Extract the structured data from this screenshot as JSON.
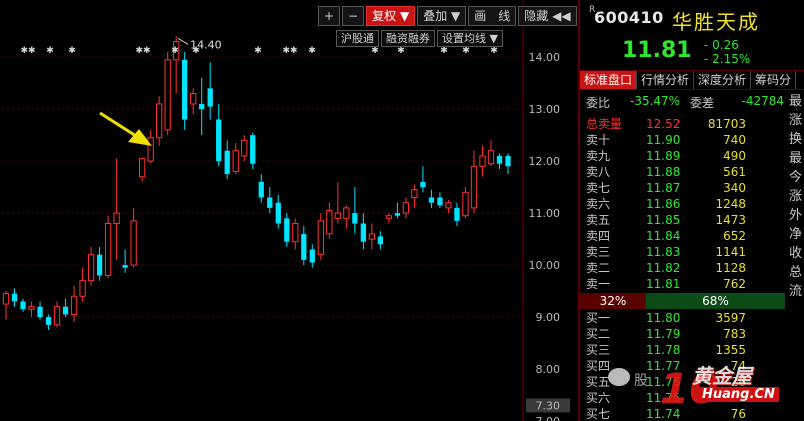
{
  "toolbar": {
    "plus": "+",
    "minus": "−",
    "adjust": "复权",
    "adjust_arrow": "▼",
    "overlay": "叠加",
    "overlay_arrow": "▼",
    "draw": "画　线",
    "hide": "隐藏",
    "hide_arrows": "◀◀"
  },
  "subbar": {
    "hk_connect": "沪股通",
    "margin": "融资融券",
    "ma_setting": "设置均线",
    "ma_arrow": "▼"
  },
  "header": {
    "r_mark": "R",
    "code": "600410",
    "name": "华胜天成",
    "price": "11.81",
    "change": "- 0.26",
    "change_pct": "- 2.15%"
  },
  "tabs": [
    "标准盘口",
    "行情分析",
    "深度分析",
    "筹码分"
  ],
  "ratio": {
    "wb_label": "委比",
    "wb_value": "-35.47%",
    "wc_label": "委差",
    "wc_value": "-42784"
  },
  "sell_total": {
    "label": "总卖量",
    "price": "12.52",
    "volume": "81703"
  },
  "asks": [
    {
      "label": "卖十",
      "price": "11.90",
      "volume": "740"
    },
    {
      "label": "卖九",
      "price": "11.89",
      "volume": "490"
    },
    {
      "label": "卖八",
      "price": "11.88",
      "volume": "561"
    },
    {
      "label": "卖七",
      "price": "11.87",
      "volume": "340"
    },
    {
      "label": "卖六",
      "price": "11.86",
      "volume": "1248"
    },
    {
      "label": "卖五",
      "price": "11.85",
      "volume": "1473"
    },
    {
      "label": "卖四",
      "price": "11.84",
      "volume": "652"
    },
    {
      "label": "卖三",
      "price": "11.83",
      "volume": "1141"
    },
    {
      "label": "卖二",
      "price": "11.82",
      "volume": "1128"
    },
    {
      "label": "卖一",
      "price": "11.81",
      "volume": "762"
    }
  ],
  "ratio_bar": {
    "sell_pct": "32%",
    "buy_pct": "68%"
  },
  "bids": [
    {
      "label": "买一",
      "price": "11.80",
      "volume": "3597"
    },
    {
      "label": "买二",
      "price": "11.79",
      "volume": "783"
    },
    {
      "label": "买三",
      "price": "11.78",
      "volume": "1355"
    },
    {
      "label": "买四",
      "price": "11.77",
      "volume": "74"
    },
    {
      "label": "买五",
      "price": "11.76",
      "volume": "26"
    },
    {
      "label": "买六",
      "price": "11.75",
      "volume": "13"
    },
    {
      "label": "买七",
      "price": "11.74",
      "volume": "76"
    }
  ],
  "side_labels": [
    "最",
    "涨",
    "换",
    "最",
    "今",
    "涨",
    "外",
    "净",
    "收",
    "总",
    "流"
  ],
  "watermark": {
    "brand": "黄金屋",
    "logo": "10",
    "url": "Huang.CN",
    "text": "股"
  },
  "colors": {
    "up": "#ff3232",
    "down": "#00e5ff",
    "accent": "#c81414",
    "price_down": "#2ee82e",
    "volume": "#e8e030"
  },
  "chart_data": {
    "type": "candlestick",
    "y_ticks": [
      "14.00",
      "13.00",
      "12.00",
      "11.00",
      "10.00",
      "9.00",
      "8.00",
      "7.30",
      "7.00"
    ],
    "ylim": [
      7.0,
      15.1
    ],
    "peak_label": "14.40",
    "event_markers": [
      "✱✱",
      "✱",
      "✱",
      "✱✱",
      "✱",
      "✱",
      "✱",
      "✱✱",
      "✱",
      "✱",
      "✱",
      "✱",
      "✱",
      "✱"
    ],
    "candles": [
      {
        "o": 9.25,
        "h": 9.5,
        "l": 8.95,
        "c": 9.45
      },
      {
        "o": 9.45,
        "h": 9.55,
        "l": 9.2,
        "c": 9.3
      },
      {
        "o": 9.3,
        "h": 9.35,
        "l": 9.1,
        "c": 9.15
      },
      {
        "o": 9.15,
        "h": 9.3,
        "l": 9.0,
        "c": 9.2
      },
      {
        "o": 9.2,
        "h": 9.3,
        "l": 8.95,
        "c": 9.0
      },
      {
        "o": 9.0,
        "h": 9.05,
        "l": 8.75,
        "c": 8.85
      },
      {
        "o": 8.85,
        "h": 9.3,
        "l": 8.8,
        "c": 9.2
      },
      {
        "o": 9.2,
        "h": 9.35,
        "l": 9.0,
        "c": 9.05
      },
      {
        "o": 9.05,
        "h": 9.6,
        "l": 8.9,
        "c": 9.4
      },
      {
        "o": 9.4,
        "h": 9.95,
        "l": 9.3,
        "c": 9.7
      },
      {
        "o": 9.7,
        "h": 10.35,
        "l": 9.6,
        "c": 10.2
      },
      {
        "o": 10.2,
        "h": 10.35,
        "l": 9.7,
        "c": 9.8
      },
      {
        "o": 9.8,
        "h": 10.95,
        "l": 9.75,
        "c": 10.8
      },
      {
        "o": 10.8,
        "h": 12.05,
        "l": 10.1,
        "c": 11.0
      },
      {
        "o": 10.0,
        "h": 10.3,
        "l": 9.85,
        "c": 9.95
      },
      {
        "o": 10.0,
        "h": 11.1,
        "l": 9.95,
        "c": 10.85
      },
      {
        "o": 11.7,
        "h": 12.0,
        "l": 11.6,
        "c": 12.05
      },
      {
        "o": 12.0,
        "h": 12.6,
        "l": 11.95,
        "c": 12.45
      },
      {
        "o": 12.45,
        "h": 13.25,
        "l": 12.3,
        "c": 13.1
      },
      {
        "o": 12.6,
        "h": 14.1,
        "l": 12.5,
        "c": 13.95
      },
      {
        "o": 13.95,
        "h": 14.4,
        "l": 13.3,
        "c": 14.3
      },
      {
        "o": 13.95,
        "h": 14.1,
        "l": 12.6,
        "c": 12.8
      },
      {
        "o": 13.1,
        "h": 13.4,
        "l": 12.9,
        "c": 13.3
      },
      {
        "o": 13.1,
        "h": 13.6,
        "l": 12.5,
        "c": 13.0
      },
      {
        "o": 13.4,
        "h": 13.9,
        "l": 12.8,
        "c": 13.05
      },
      {
        "o": 12.8,
        "h": 13.1,
        "l": 11.9,
        "c": 12.0
      },
      {
        "o": 12.2,
        "h": 12.4,
        "l": 11.65,
        "c": 11.75
      },
      {
        "o": 11.8,
        "h": 12.35,
        "l": 11.75,
        "c": 12.2
      },
      {
        "o": 12.1,
        "h": 12.5,
        "l": 12.0,
        "c": 12.4
      },
      {
        "o": 12.5,
        "h": 12.55,
        "l": 11.85,
        "c": 11.95
      },
      {
        "o": 11.6,
        "h": 11.75,
        "l": 11.2,
        "c": 11.3
      },
      {
        "o": 11.3,
        "h": 11.5,
        "l": 11.0,
        "c": 11.1
      },
      {
        "o": 11.2,
        "h": 11.35,
        "l": 10.7,
        "c": 10.8
      },
      {
        "o": 10.9,
        "h": 11.0,
        "l": 10.35,
        "c": 10.45
      },
      {
        "o": 10.45,
        "h": 10.9,
        "l": 10.3,
        "c": 10.8
      },
      {
        "o": 10.6,
        "h": 10.75,
        "l": 10.0,
        "c": 10.1
      },
      {
        "o": 10.3,
        "h": 10.4,
        "l": 9.95,
        "c": 10.05
      },
      {
        "o": 10.2,
        "h": 11.0,
        "l": 10.1,
        "c": 10.85
      },
      {
        "o": 10.6,
        "h": 11.2,
        "l": 10.5,
        "c": 11.05
      },
      {
        "o": 10.9,
        "h": 11.6,
        "l": 10.8,
        "c": 11.0
      },
      {
        "o": 10.9,
        "h": 11.15,
        "l": 10.7,
        "c": 11.1
      },
      {
        "o": 11.0,
        "h": 11.5,
        "l": 10.6,
        "c": 10.8
      },
      {
        "o": 10.8,
        "h": 11.0,
        "l": 10.3,
        "c": 10.45
      },
      {
        "o": 10.5,
        "h": 10.8,
        "l": 10.3,
        "c": 10.6
      },
      {
        "o": 10.55,
        "h": 10.65,
        "l": 10.3,
        "c": 10.4
      },
      {
        "o": 10.9,
        "h": 11.0,
        "l": 10.8,
        "c": 10.95
      },
      {
        "o": 11.0,
        "h": 11.2,
        "l": 10.9,
        "c": 10.95
      },
      {
        "o": 11.0,
        "h": 11.3,
        "l": 10.9,
        "c": 11.2
      },
      {
        "o": 11.3,
        "h": 11.55,
        "l": 11.1,
        "c": 11.45
      },
      {
        "o": 11.6,
        "h": 11.9,
        "l": 11.4,
        "c": 11.5
      },
      {
        "o": 11.3,
        "h": 11.45,
        "l": 11.1,
        "c": 11.2
      },
      {
        "o": 11.3,
        "h": 11.4,
        "l": 11.1,
        "c": 11.15
      },
      {
        "o": 11.1,
        "h": 11.25,
        "l": 11.0,
        "c": 11.2
      },
      {
        "o": 11.1,
        "h": 11.2,
        "l": 10.75,
        "c": 10.85
      },
      {
        "o": 10.95,
        "h": 11.5,
        "l": 10.9,
        "c": 11.4
      },
      {
        "o": 11.1,
        "h": 12.2,
        "l": 11.0,
        "c": 11.9
      },
      {
        "o": 11.9,
        "h": 12.3,
        "l": 11.7,
        "c": 12.1
      },
      {
        "o": 11.95,
        "h": 12.4,
        "l": 11.9,
        "c": 12.2
      },
      {
        "o": 12.1,
        "h": 12.15,
        "l": 11.85,
        "c": 11.95
      },
      {
        "o": 12.1,
        "h": 12.15,
        "l": 11.75,
        "c": 11.9
      }
    ]
  }
}
